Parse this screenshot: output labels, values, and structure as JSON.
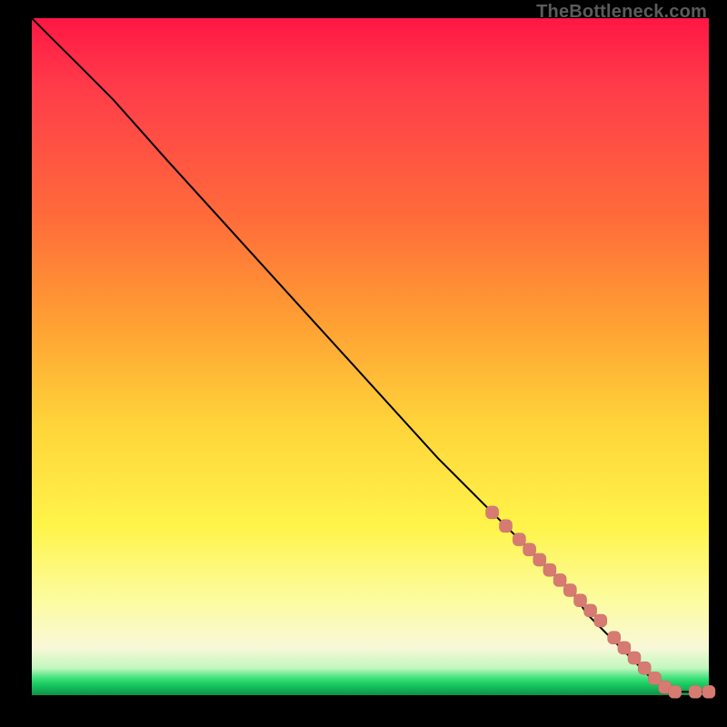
{
  "watermark": "TheBottleneck.com",
  "colors": {
    "page_bg": "#000000",
    "gradient_top": "#ff1744",
    "gradient_bottom": "#0f8f4a",
    "line": "#000000",
    "marker": "#d77b72"
  },
  "chart_data": {
    "type": "line",
    "title": "",
    "xlabel": "",
    "ylabel": "",
    "xlim": [
      0,
      100
    ],
    "ylim": [
      0,
      100
    ],
    "grid": false,
    "legend": false,
    "series": [
      {
        "name": "curve",
        "x": [
          0,
          3,
          7,
          12,
          20,
          30,
          40,
          50,
          60,
          68,
          72,
          75,
          78,
          80,
          82,
          84,
          86,
          88,
          90,
          92,
          94,
          96,
          98,
          100
        ],
        "y": [
          100,
          97,
          93,
          88,
          79,
          68,
          57,
          46,
          35,
          27,
          23,
          20,
          17,
          15,
          12,
          10,
          8,
          6,
          4,
          2,
          1,
          0.5,
          0.5,
          0.5
        ]
      }
    ],
    "markers": [
      {
        "x": 68,
        "y": 27
      },
      {
        "x": 70,
        "y": 25
      },
      {
        "x": 72,
        "y": 23
      },
      {
        "x": 73.5,
        "y": 21.5
      },
      {
        "x": 75,
        "y": 20
      },
      {
        "x": 76.5,
        "y": 18.5
      },
      {
        "x": 78,
        "y": 17
      },
      {
        "x": 79.5,
        "y": 15.5
      },
      {
        "x": 81,
        "y": 14
      },
      {
        "x": 82.5,
        "y": 12.5
      },
      {
        "x": 84,
        "y": 11
      },
      {
        "x": 86,
        "y": 8.5
      },
      {
        "x": 87.5,
        "y": 7
      },
      {
        "x": 89,
        "y": 5.5
      },
      {
        "x": 90.5,
        "y": 4
      },
      {
        "x": 92,
        "y": 2.5
      },
      {
        "x": 93.5,
        "y": 1.2
      },
      {
        "x": 95,
        "y": 0.5
      },
      {
        "x": 98,
        "y": 0.5
      },
      {
        "x": 100,
        "y": 0.5
      }
    ]
  }
}
